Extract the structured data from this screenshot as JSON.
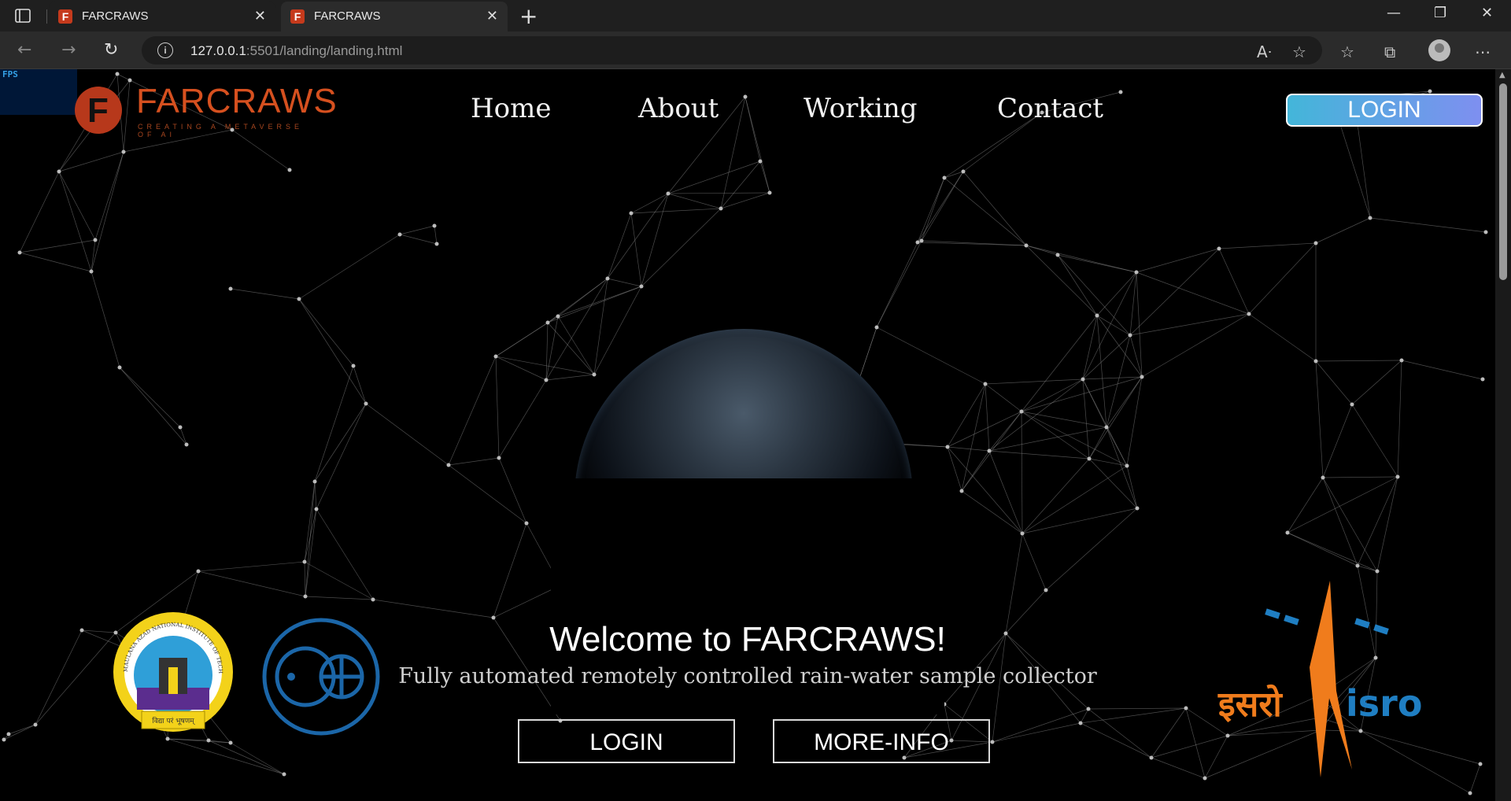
{
  "browser": {
    "tabs": [
      {
        "title": "FARCRAWS",
        "favicon": "F",
        "active": false
      },
      {
        "title": "FARCRAWS",
        "favicon": "F",
        "active": true
      }
    ],
    "url_host": "127.0.0.1",
    "url_path": ":5501/landing/landing.html"
  },
  "overlay": {
    "fps_label": "FPS"
  },
  "site": {
    "logo_text": "FARCRAWS",
    "logo_tagline": "CREATING A METAVERSE OF AI",
    "nav": [
      "Home",
      "About",
      "Working",
      "Contact"
    ],
    "login_top": "LOGIN",
    "hero": {
      "title": "Welcome to FARCRAWS!",
      "subtitle": "Fully automated remotely controlled rain-water sample collector"
    },
    "buttons": {
      "login": "LOGIN",
      "more_info": "MORE-INFO"
    },
    "partner_logos": {
      "nit": {
        "ring_text": "MAULANA AZAD NATIONAL INSTITUTE OF TECHNOLOGY BHOPAL",
        "motto": "विद्या परं भूषणम्"
      },
      "isro": {
        "hindi": "इसरो",
        "english": "isro"
      }
    }
  },
  "colors": {
    "brand": "#d6501f",
    "login_gradient_start": "#43b6d9",
    "login_gradient_end": "#7e8ff0",
    "isro_orange": "#f07c1c",
    "isro_blue": "#1f7ec2",
    "iuac_blue": "#1b66a8"
  }
}
